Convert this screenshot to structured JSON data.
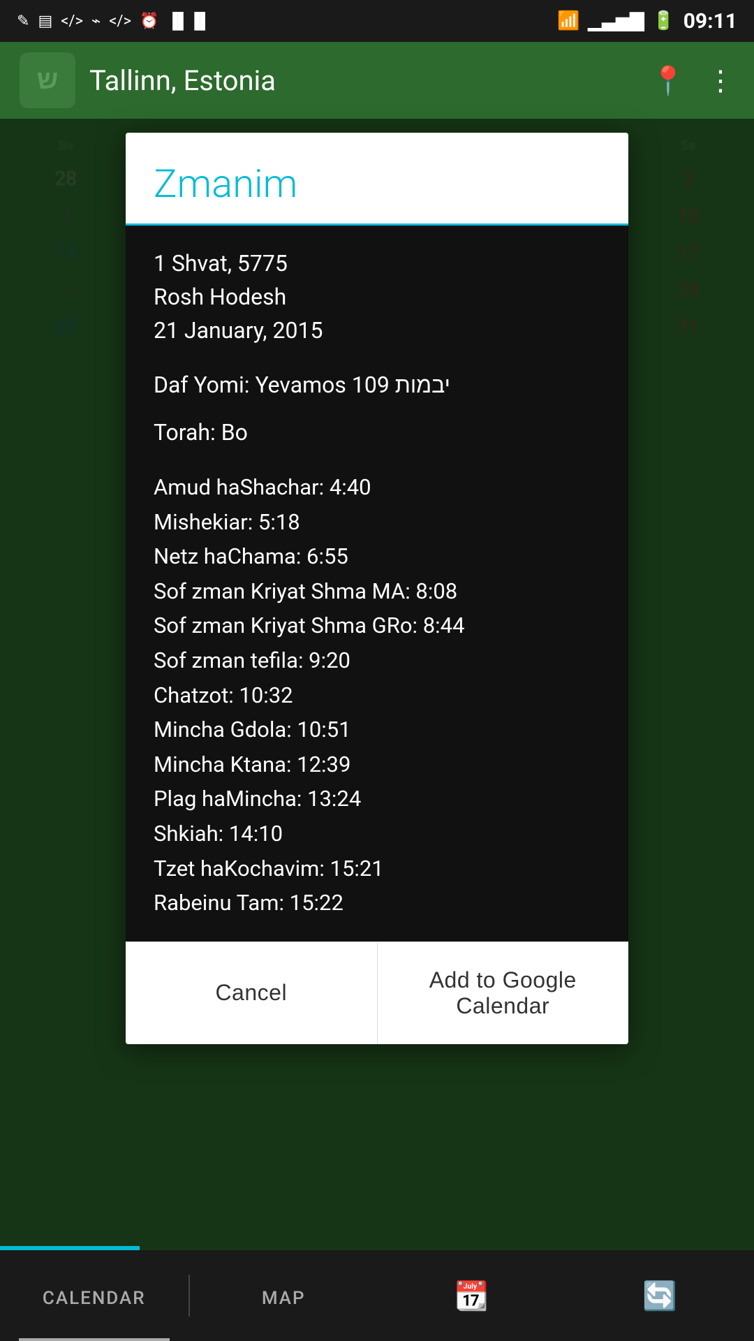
{
  "statusBar": {
    "time": "09:11",
    "icons": [
      "feather",
      "sim",
      "music",
      "usb",
      "code",
      "clock",
      "barcode"
    ]
  },
  "header": {
    "location": "Tallinn, Estonia",
    "logoChar": "ש"
  },
  "dialog": {
    "title": "Zmanim",
    "hebrewDate": "1 Shvat, 5775",
    "hebrewEvent": "Rosh Hodesh",
    "gregorianDate": "21 January, 2015",
    "dafYomi": "Daf Yomi: Yevamos 109 יבמות",
    "torah": "Torah: Bo",
    "zmanim": [
      "Amud haShachar: 4:40",
      "Mishekiar: 5:18",
      "Netz haChama: 6:55",
      "Sof zman Kriyat Shma MA: 8:08",
      "Sof zman Kriyat Shma GRo: 8:44",
      "Sof zman tefila: 9:20",
      "Chatzot: 10:32",
      "Mincha Gdola: 10:51",
      "Mincha Ktana: 12:39",
      "Plag haMincha: 13:24",
      "Shkiah: 14:10",
      "Tzet haKochavim: 15:21",
      "Rabeinu Tam: 15:22"
    ],
    "cancelButton": "Cancel",
    "addButton": "Add to Google Calendar"
  },
  "bottomNav": {
    "items": [
      {
        "label": "CALENDAR",
        "icon": "📅"
      },
      {
        "label": "MAP",
        "icon": ""
      }
    ],
    "icons": [
      "📆",
      "🔄"
    ]
  }
}
